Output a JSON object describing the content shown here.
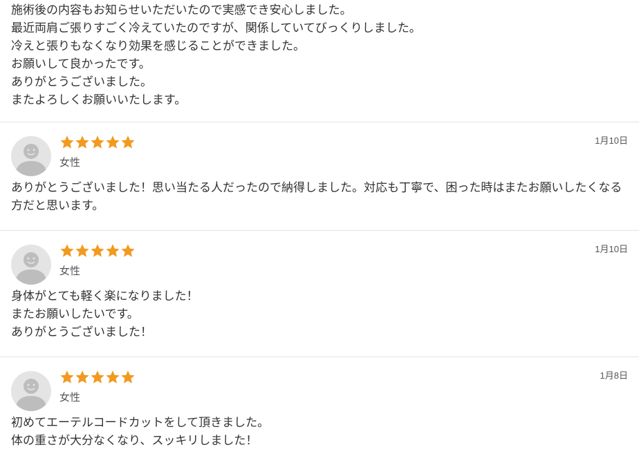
{
  "first_review": {
    "lines": "施術後の内容もお知らせいただいたので実感でき安心しました。\n最近両肩ご張りすごく冷えていたのですが、関係していてびっくりしました。\n冷えと張りもなくなり効果を感じることができました。\nお願いして良かったです。\nありがとうございました。\nまたよろしくお願いいたします。"
  },
  "reviews": [
    {
      "rating": 5,
      "gender": "女性",
      "date": "1月10日",
      "text": "ありがとうございました！思い当たる人だったので納得しました。対応も丁寧で、困った時はまたお願いしたくなる方だと思います。"
    },
    {
      "rating": 5,
      "gender": "女性",
      "date": "1月10日",
      "text": "身体がとても軽く楽になりました！\nまたお願いしたいです。\nありがとうございました！"
    },
    {
      "rating": 5,
      "gender": "女性",
      "date": "1月8日",
      "text": "初めてエーテルコードカットをして頂きました。\n体の重さが大分なくなり、スッキリしました！"
    }
  ],
  "colors": {
    "star": "#f29a1f",
    "avatar_bg": "#e4e4e4",
    "avatar_fg": "#bdbdbd",
    "divider": "#e3e3e3"
  },
  "icons": {
    "avatar": "user-silhouette-icon",
    "star": "star-icon"
  }
}
